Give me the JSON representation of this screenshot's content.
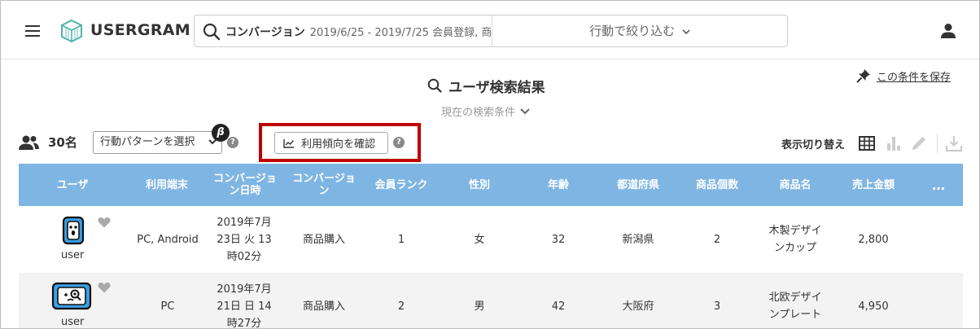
{
  "app": {
    "name": "USERGRAM"
  },
  "search": {
    "keyword": "コンバージョン",
    "detail": "2019/6/25 - 2019/7/25 会員登録, 商品",
    "filter_label": "行動で絞り込む"
  },
  "page": {
    "title": "ユーザ検索結果",
    "current_conditions": "現在の検索条件",
    "save_label": "この条件を保存"
  },
  "toolbar": {
    "count": "30名",
    "pattern_select": "行動パターンを選択",
    "beta": "β",
    "help": "?",
    "trend_button": "利用傾向を確認",
    "view_toggle_label": "表示切り替え"
  },
  "table": {
    "columns": [
      "ユーザ",
      "利用端末",
      "コンバージョン日時",
      "コンバージョン",
      "会員ランク",
      "性別",
      "年齢",
      "都道府県",
      "商品個数",
      "商品名",
      "売上金額",
      "…"
    ],
    "rows": [
      {
        "user": "user",
        "device": "PC, Android",
        "datetime": "2019年7月23日 火 13時02分",
        "conversion": "商品購入",
        "rank": "1",
        "gender": "女",
        "age": "32",
        "prefecture": "新潟県",
        "quantity": "2",
        "product": "木製デザインカップ",
        "sales": "2,800"
      },
      {
        "user": "user",
        "device": "PC",
        "datetime": "2019年7月21日 日 14時27分",
        "conversion": "商品購入",
        "rank": "2",
        "gender": "男",
        "age": "42",
        "prefecture": "大阪府",
        "quantity": "3",
        "product": "北欧デザインプレート",
        "sales": "4,950"
      }
    ]
  },
  "colors": {
    "header_bg": "#7fb5e3",
    "highlight": "#c00000",
    "avatar_blue": "#3a9ee4"
  }
}
